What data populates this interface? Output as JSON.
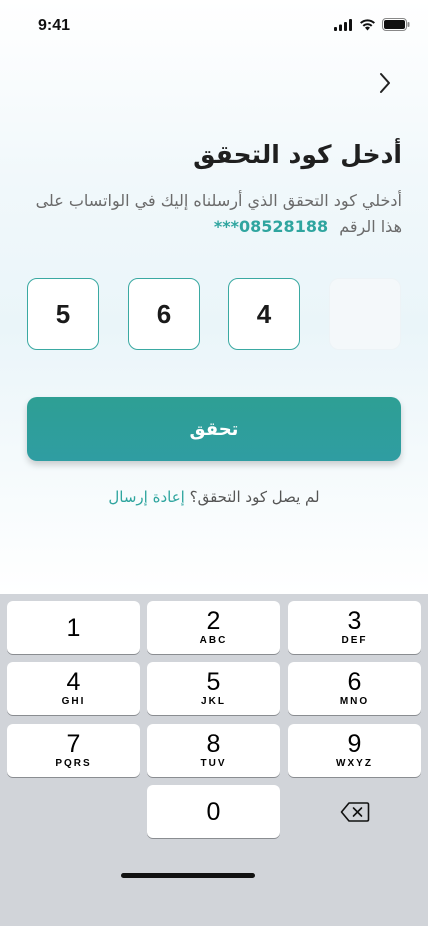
{
  "status": {
    "time": "9:41"
  },
  "header": {
    "title": "أدخل كود التحقق"
  },
  "subtitle": {
    "text": "أدخلي كود التحقق الذي أرسلناه إليك في الواتساب على هذا الرقم",
    "phone": "***08528188"
  },
  "otp": [
    "4",
    "6",
    "5",
    ""
  ],
  "verify_label": "تحقق",
  "resend": {
    "prompt": "لم يصل كود التحقق؟",
    "link": "إعادة إرسال"
  },
  "keypad": [
    {
      "digit": "1",
      "letters": ""
    },
    {
      "digit": "2",
      "letters": "ABC"
    },
    {
      "digit": "3",
      "letters": "DEF"
    },
    {
      "digit": "4",
      "letters": "GHI"
    },
    {
      "digit": "5",
      "letters": "JKL"
    },
    {
      "digit": "6",
      "letters": "MNO"
    },
    {
      "digit": "7",
      "letters": "PQRS"
    },
    {
      "digit": "8",
      "letters": "TUV"
    },
    {
      "digit": "9",
      "letters": "WXYZ"
    },
    {
      "digit": "0",
      "letters": ""
    }
  ],
  "colors": {
    "accent": "#2fa59f",
    "keyboard_bg": "#d1d4d9"
  }
}
